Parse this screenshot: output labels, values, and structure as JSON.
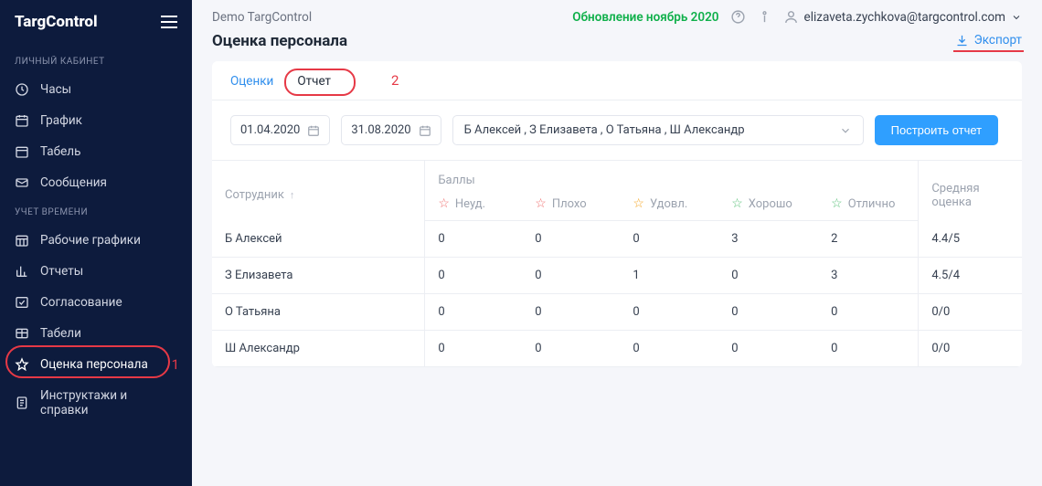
{
  "brand": "TargControl",
  "sidebar": {
    "section1_label": "ЛИЧНЫЙ КАБИНЕТ",
    "personal": [
      {
        "label": "Часы"
      },
      {
        "label": "График"
      },
      {
        "label": "Табель"
      },
      {
        "label": "Сообщения"
      }
    ],
    "section2_label": "УЧЕТ ВРЕМЕНИ",
    "time": [
      {
        "label": "Рабочие графики"
      },
      {
        "label": "Отчеты"
      },
      {
        "label": "Согласование"
      },
      {
        "label": "Табели"
      },
      {
        "label": "Оценка персонала"
      },
      {
        "label": "Инструктажи и справки"
      }
    ]
  },
  "annotation1": "1",
  "annotation2": "2",
  "topbar": {
    "project": "Demo TargControl",
    "update": "Обновление ноябрь 2020",
    "user": "elizaveta.zychkova@targcontrol.com"
  },
  "page_title": "Оценка персонала",
  "export_label": "Экспорт",
  "tabs": {
    "scores": "Оценки",
    "report": "Отчет"
  },
  "filters": {
    "date_from": "01.04.2020",
    "date_to": "31.08.2020",
    "people": "Б Алексей , З Елизавета , О Татьяна , Ш Александр",
    "build": "Построить отчет"
  },
  "table": {
    "col_employee": "Сотрудник",
    "col_points": "Баллы",
    "col_avg": "Средняя оценка",
    "ratings": [
      "Неуд.",
      "Плохо",
      "Удовл.",
      "Хорошо",
      "Отлично"
    ],
    "rows": [
      {
        "name": "Б Алексей",
        "vals": [
          "0",
          "0",
          "0",
          "3",
          "2"
        ],
        "avg": "4.4/5"
      },
      {
        "name": "З Елизавета",
        "vals": [
          "0",
          "0",
          "1",
          "0",
          "3"
        ],
        "avg": "4.5/4"
      },
      {
        "name": "О Татьяна",
        "vals": [
          "0",
          "0",
          "0",
          "0",
          "0"
        ],
        "avg": "0/0"
      },
      {
        "name": "Ш Александр",
        "vals": [
          "0",
          "0",
          "0",
          "0",
          "0"
        ],
        "avg": "0/0"
      }
    ]
  }
}
